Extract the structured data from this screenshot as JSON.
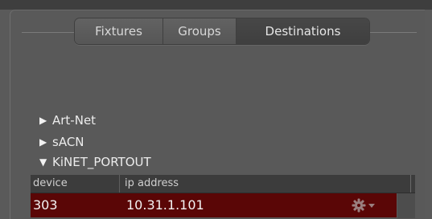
{
  "tabs": [
    {
      "label": "Fixtures",
      "active": false
    },
    {
      "label": "Groups",
      "active": false
    },
    {
      "label": "Destinations",
      "active": true
    }
  ],
  "tree": [
    {
      "label": "Art-Net",
      "expanded": false
    },
    {
      "label": "sACN",
      "expanded": false
    },
    {
      "label": "KiNET_PORTOUT",
      "expanded": true
    }
  ],
  "table": {
    "columns": [
      "device",
      "ip address"
    ],
    "rows": [
      {
        "device": "303",
        "ip": "10.31.1.101",
        "selected": true
      }
    ]
  },
  "colors": {
    "background": "#595959",
    "selected_row": "#5a0606",
    "header": "#3c3c3c"
  },
  "icons": {
    "row_action": "gear-dropdown-icon",
    "collapsed": "triangle-right-icon",
    "expanded": "triangle-down-icon"
  }
}
